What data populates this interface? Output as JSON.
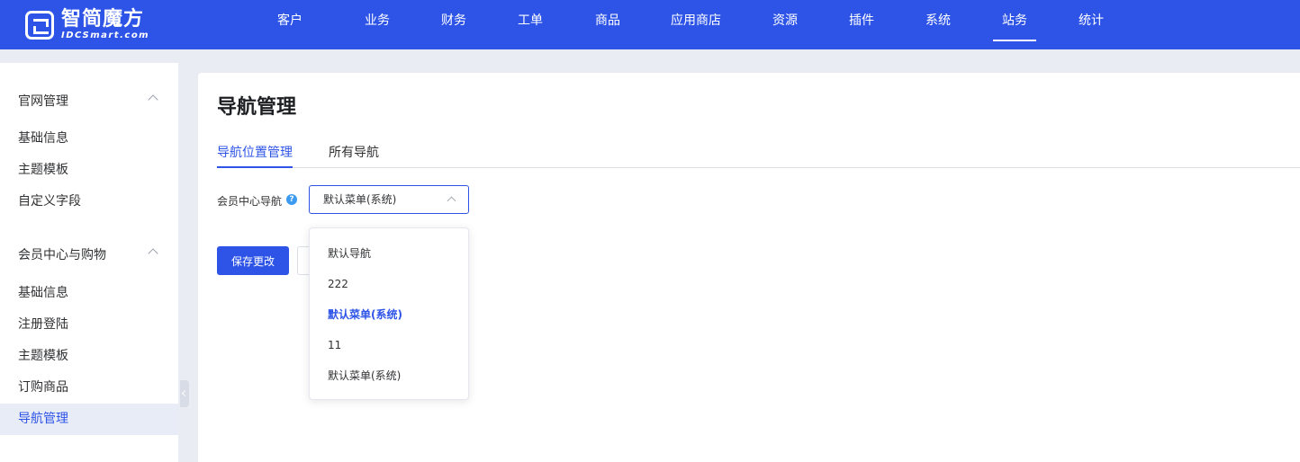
{
  "brand": {
    "name_cn": "智简魔方",
    "name_en": "IDCSmart.com"
  },
  "topnav": {
    "items": [
      {
        "label": "客户"
      },
      {
        "label": "业务"
      },
      {
        "label": "财务"
      },
      {
        "label": "工单"
      },
      {
        "label": "商品"
      },
      {
        "label": "应用商店"
      },
      {
        "label": "资源"
      },
      {
        "label": "插件"
      },
      {
        "label": "系统"
      },
      {
        "label": "站务"
      },
      {
        "label": "统计"
      }
    ],
    "active": "站务"
  },
  "sidebar": {
    "groups": [
      {
        "title": "官网管理",
        "items": [
          {
            "label": "基础信息"
          },
          {
            "label": "主题模板"
          },
          {
            "label": "自定义字段"
          }
        ]
      },
      {
        "title": "会员中心与购物",
        "items": [
          {
            "label": "基础信息"
          },
          {
            "label": "注册登陆"
          },
          {
            "label": "主题模板"
          },
          {
            "label": "订购商品"
          },
          {
            "label": "导航管理"
          }
        ]
      }
    ],
    "active_item": "导航管理"
  },
  "main": {
    "title": "导航管理",
    "tabs": [
      {
        "label": "导航位置管理"
      },
      {
        "label": "所有导航"
      }
    ],
    "active_tab": "导航位置管理",
    "form": {
      "field_label": "会员中心导航",
      "help_icon": "?",
      "selected_value": "默认菜单(系统)",
      "save_label": "保存更改"
    },
    "dropdown_options": [
      {
        "label": "默认导航"
      },
      {
        "label": "222"
      },
      {
        "label": "默认菜单(系统)"
      },
      {
        "label": "11"
      },
      {
        "label": "默认菜单(系统)"
      }
    ],
    "highlighted_option_index": 2
  },
  "colors": {
    "primary": "#2e54e7",
    "background": "#e9ecf3",
    "active_row": "#e8ecf7"
  }
}
